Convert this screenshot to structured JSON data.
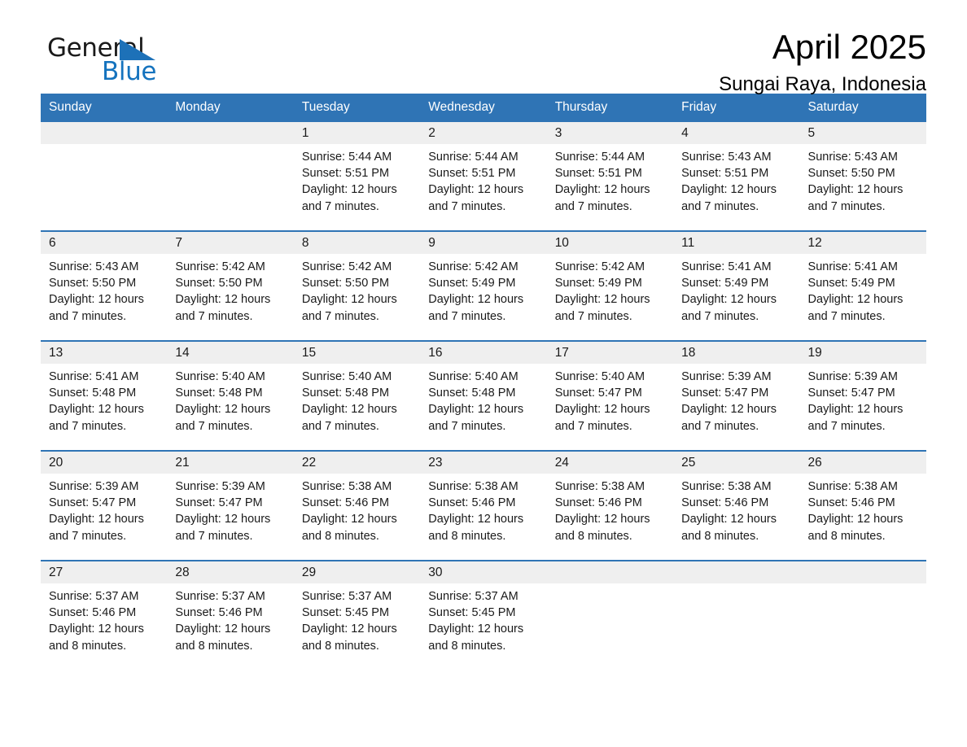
{
  "brand": {
    "word_one": "General",
    "word_two": "Blue",
    "triangle_icon": "triangle-right-icon",
    "accent_color": "#1573be"
  },
  "header": {
    "month_title": "April 2025",
    "location": "Sungai Raya, Indonesia"
  },
  "calendar": {
    "header_bg": "#2f74b5",
    "daynum_bg": "#efefef",
    "weekday_headers": [
      "Sunday",
      "Monday",
      "Tuesday",
      "Wednesday",
      "Thursday",
      "Friday",
      "Saturday"
    ],
    "weeks": [
      [
        {
          "day": "",
          "sunrise": "",
          "sunset": "",
          "daylight": ""
        },
        {
          "day": "",
          "sunrise": "",
          "sunset": "",
          "daylight": ""
        },
        {
          "day": "1",
          "sunrise": "Sunrise: 5:44 AM",
          "sunset": "Sunset: 5:51 PM",
          "daylight": "Daylight: 12 hours and 7 minutes."
        },
        {
          "day": "2",
          "sunrise": "Sunrise: 5:44 AM",
          "sunset": "Sunset: 5:51 PM",
          "daylight": "Daylight: 12 hours and 7 minutes."
        },
        {
          "day": "3",
          "sunrise": "Sunrise: 5:44 AM",
          "sunset": "Sunset: 5:51 PM",
          "daylight": "Daylight: 12 hours and 7 minutes."
        },
        {
          "day": "4",
          "sunrise": "Sunrise: 5:43 AM",
          "sunset": "Sunset: 5:51 PM",
          "daylight": "Daylight: 12 hours and 7 minutes."
        },
        {
          "day": "5",
          "sunrise": "Sunrise: 5:43 AM",
          "sunset": "Sunset: 5:50 PM",
          "daylight": "Daylight: 12 hours and 7 minutes."
        }
      ],
      [
        {
          "day": "6",
          "sunrise": "Sunrise: 5:43 AM",
          "sunset": "Sunset: 5:50 PM",
          "daylight": "Daylight: 12 hours and 7 minutes."
        },
        {
          "day": "7",
          "sunrise": "Sunrise: 5:42 AM",
          "sunset": "Sunset: 5:50 PM",
          "daylight": "Daylight: 12 hours and 7 minutes."
        },
        {
          "day": "8",
          "sunrise": "Sunrise: 5:42 AM",
          "sunset": "Sunset: 5:50 PM",
          "daylight": "Daylight: 12 hours and 7 minutes."
        },
        {
          "day": "9",
          "sunrise": "Sunrise: 5:42 AM",
          "sunset": "Sunset: 5:49 PM",
          "daylight": "Daylight: 12 hours and 7 minutes."
        },
        {
          "day": "10",
          "sunrise": "Sunrise: 5:42 AM",
          "sunset": "Sunset: 5:49 PM",
          "daylight": "Daylight: 12 hours and 7 minutes."
        },
        {
          "day": "11",
          "sunrise": "Sunrise: 5:41 AM",
          "sunset": "Sunset: 5:49 PM",
          "daylight": "Daylight: 12 hours and 7 minutes."
        },
        {
          "day": "12",
          "sunrise": "Sunrise: 5:41 AM",
          "sunset": "Sunset: 5:49 PM",
          "daylight": "Daylight: 12 hours and 7 minutes."
        }
      ],
      [
        {
          "day": "13",
          "sunrise": "Sunrise: 5:41 AM",
          "sunset": "Sunset: 5:48 PM",
          "daylight": "Daylight: 12 hours and 7 minutes."
        },
        {
          "day": "14",
          "sunrise": "Sunrise: 5:40 AM",
          "sunset": "Sunset: 5:48 PM",
          "daylight": "Daylight: 12 hours and 7 minutes."
        },
        {
          "day": "15",
          "sunrise": "Sunrise: 5:40 AM",
          "sunset": "Sunset: 5:48 PM",
          "daylight": "Daylight: 12 hours and 7 minutes."
        },
        {
          "day": "16",
          "sunrise": "Sunrise: 5:40 AM",
          "sunset": "Sunset: 5:48 PM",
          "daylight": "Daylight: 12 hours and 7 minutes."
        },
        {
          "day": "17",
          "sunrise": "Sunrise: 5:40 AM",
          "sunset": "Sunset: 5:47 PM",
          "daylight": "Daylight: 12 hours and 7 minutes."
        },
        {
          "day": "18",
          "sunrise": "Sunrise: 5:39 AM",
          "sunset": "Sunset: 5:47 PM",
          "daylight": "Daylight: 12 hours and 7 minutes."
        },
        {
          "day": "19",
          "sunrise": "Sunrise: 5:39 AM",
          "sunset": "Sunset: 5:47 PM",
          "daylight": "Daylight: 12 hours and 7 minutes."
        }
      ],
      [
        {
          "day": "20",
          "sunrise": "Sunrise: 5:39 AM",
          "sunset": "Sunset: 5:47 PM",
          "daylight": "Daylight: 12 hours and 7 minutes."
        },
        {
          "day": "21",
          "sunrise": "Sunrise: 5:39 AM",
          "sunset": "Sunset: 5:47 PM",
          "daylight": "Daylight: 12 hours and 7 minutes."
        },
        {
          "day": "22",
          "sunrise": "Sunrise: 5:38 AM",
          "sunset": "Sunset: 5:46 PM",
          "daylight": "Daylight: 12 hours and 8 minutes."
        },
        {
          "day": "23",
          "sunrise": "Sunrise: 5:38 AM",
          "sunset": "Sunset: 5:46 PM",
          "daylight": "Daylight: 12 hours and 8 minutes."
        },
        {
          "day": "24",
          "sunrise": "Sunrise: 5:38 AM",
          "sunset": "Sunset: 5:46 PM",
          "daylight": "Daylight: 12 hours and 8 minutes."
        },
        {
          "day": "25",
          "sunrise": "Sunrise: 5:38 AM",
          "sunset": "Sunset: 5:46 PM",
          "daylight": "Daylight: 12 hours and 8 minutes."
        },
        {
          "day": "26",
          "sunrise": "Sunrise: 5:38 AM",
          "sunset": "Sunset: 5:46 PM",
          "daylight": "Daylight: 12 hours and 8 minutes."
        }
      ],
      [
        {
          "day": "27",
          "sunrise": "Sunrise: 5:37 AM",
          "sunset": "Sunset: 5:46 PM",
          "daylight": "Daylight: 12 hours and 8 minutes."
        },
        {
          "day": "28",
          "sunrise": "Sunrise: 5:37 AM",
          "sunset": "Sunset: 5:46 PM",
          "daylight": "Daylight: 12 hours and 8 minutes."
        },
        {
          "day": "29",
          "sunrise": "Sunrise: 5:37 AM",
          "sunset": "Sunset: 5:45 PM",
          "daylight": "Daylight: 12 hours and 8 minutes."
        },
        {
          "day": "30",
          "sunrise": "Sunrise: 5:37 AM",
          "sunset": "Sunset: 5:45 PM",
          "daylight": "Daylight: 12 hours and 8 minutes."
        },
        {
          "day": "",
          "sunrise": "",
          "sunset": "",
          "daylight": ""
        },
        {
          "day": "",
          "sunrise": "",
          "sunset": "",
          "daylight": ""
        },
        {
          "day": "",
          "sunrise": "",
          "sunset": "",
          "daylight": ""
        }
      ]
    ]
  }
}
